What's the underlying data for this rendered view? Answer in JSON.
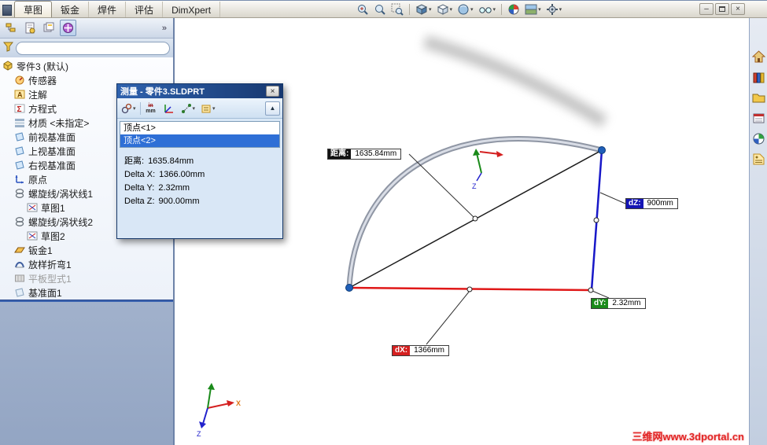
{
  "window": {
    "tabs": [
      {
        "label": "草图",
        "active": true
      },
      {
        "label": "钣金",
        "active": false
      },
      {
        "label": "焊件",
        "active": false
      },
      {
        "label": "评估",
        "active": false
      },
      {
        "label": "DimXpert",
        "active": false
      }
    ],
    "controls": {
      "minimize": "–",
      "close": "×"
    }
  },
  "hud_toolbar": {
    "icons": [
      "zoom-in-out",
      "zoom-to-fit",
      "zoom-to-area",
      "section-view",
      "view-orientation",
      "display-style",
      "hide-show-items",
      "edit-appearance",
      "apply-scene",
      "view-settings"
    ]
  },
  "left_panel": {
    "overflow_chevron": "»",
    "manager_tabs": [
      "feature-manager",
      "property-manager",
      "configuration-manager",
      "dimxpert-manager"
    ],
    "tree": {
      "root": "零件3 (默认)",
      "items": [
        {
          "label": "传感器",
          "icon": "sensors"
        },
        {
          "label": "注解",
          "icon": "annotations"
        },
        {
          "label": "方程式",
          "icon": "equations"
        },
        {
          "label": "材质 <未指定>",
          "icon": "material"
        },
        {
          "label": "前视基准面",
          "icon": "plane"
        },
        {
          "label": "上视基准面",
          "icon": "plane"
        },
        {
          "label": "右视基准面",
          "icon": "plane"
        },
        {
          "label": "原点",
          "icon": "origin"
        },
        {
          "label": "螺旋线/涡状线1",
          "icon": "helix"
        },
        {
          "label": "草图1",
          "icon": "sketch"
        },
        {
          "label": "螺旋线/涡状线2",
          "icon": "helix"
        },
        {
          "label": "草图2",
          "icon": "sketch"
        },
        {
          "label": "钣金1",
          "icon": "sheet-metal"
        },
        {
          "label": "放样折弯1",
          "icon": "lofted-bend"
        },
        {
          "label": "平板型式1",
          "icon": "flat-pattern",
          "suppressed": true
        },
        {
          "label": "基准面1",
          "icon": "plane"
        }
      ]
    }
  },
  "measure_dialog": {
    "title": "测量 - 零件3.SLDPRT",
    "close": "×",
    "collapse": "▲",
    "units": {
      "top": "in",
      "bottom": "mm"
    },
    "selection": [
      "顶点<1>",
      "顶点<2>"
    ],
    "selected_index": 1,
    "results": [
      {
        "label": "距离:",
        "value": "1635.84mm"
      },
      {
        "label": "Delta X:",
        "value": "1366.00mm"
      },
      {
        "label": "Delta Y:",
        "value": "2.32mm"
      },
      {
        "label": "Delta Z:",
        "value": "900.00mm"
      }
    ]
  },
  "viewport": {
    "measure_labels": [
      {
        "tag": "距离:",
        "value": "1635.84mm",
        "color": "#111111"
      },
      {
        "tag": "dX:",
        "value": "1366mm",
        "color": "#d42020"
      },
      {
        "tag": "dY:",
        "value": "2.32mm",
        "color": "#1a8a1a"
      },
      {
        "tag": "dZ:",
        "value": "900mm",
        "color": "#1515b5"
      }
    ],
    "triad": {
      "x": "X",
      "z": "Z"
    },
    "vertex_triad": {
      "z": "Z"
    },
    "watermark": "三维网www.3dportal.cn"
  },
  "task_pane": {
    "icons": [
      "solidworks-resources",
      "design-library",
      "file-explorer",
      "view-palette",
      "appearances",
      "custom-properties"
    ]
  },
  "colors": {
    "dx": "#d42020",
    "dy": "#1a8a1a",
    "dz": "#1515b5",
    "selection": "#2e6fd6",
    "title_bar": "#2f62ae"
  }
}
